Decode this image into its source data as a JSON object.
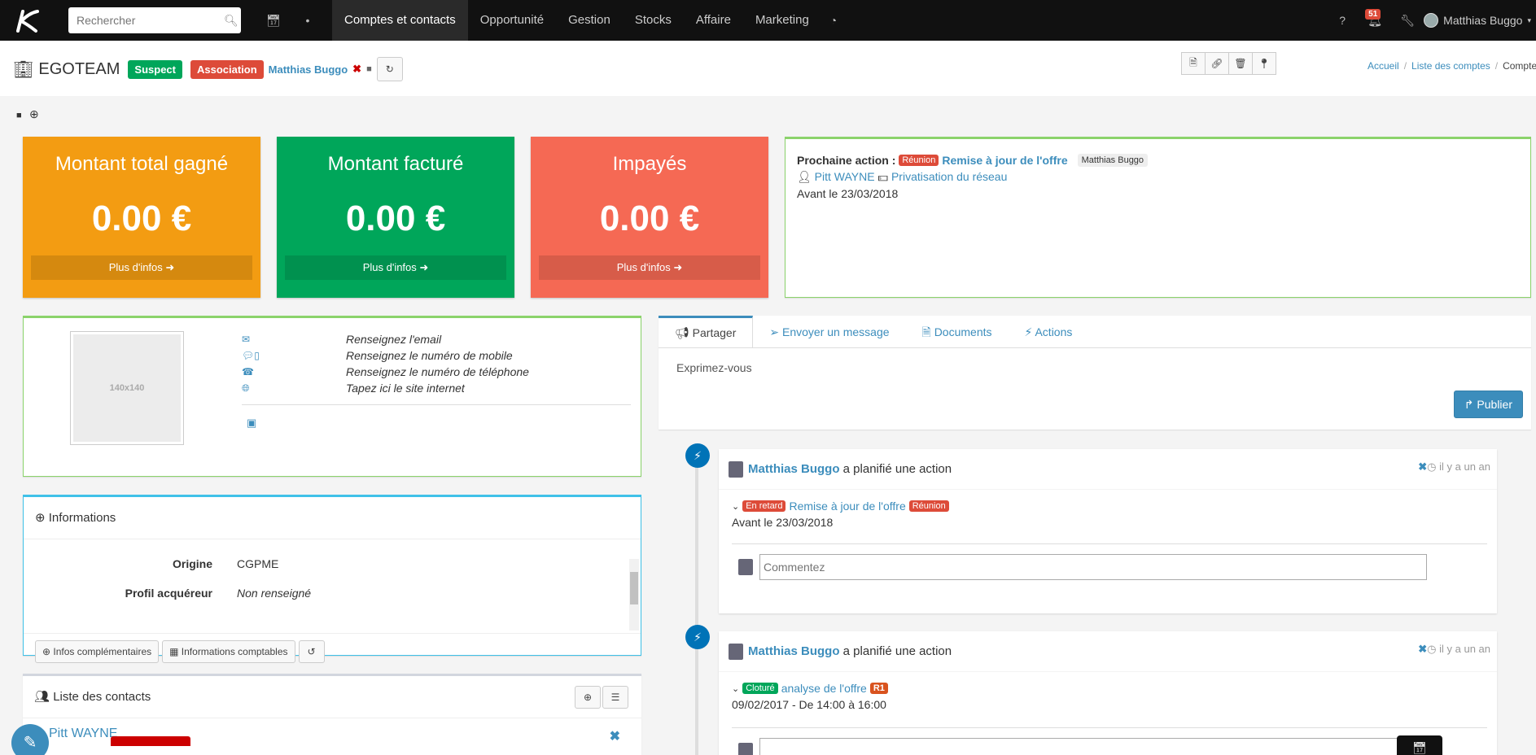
{
  "nav": {
    "search_placeholder": "Rechercher",
    "items": [
      "Comptes et contacts",
      "Opportunité",
      "Gestion",
      "Stocks",
      "Affaire",
      "Marketing"
    ],
    "notifications_count": "51",
    "user_name": "Matthias Buggo"
  },
  "header": {
    "title": "EGOTEAM",
    "status_label": "Suspect",
    "type_label": "Association",
    "owner": "Matthias Buggo",
    "breadcrumb": [
      "Accueil",
      "Liste des comptes",
      "Compte"
    ]
  },
  "stats": [
    {
      "title": "Montant total gagné",
      "amount": "0.00 €",
      "more": "Plus d'infos",
      "color": "#f39c12"
    },
    {
      "title": "Montant facturé",
      "amount": "0.00 €",
      "more": "Plus d'infos",
      "color": "#00a65a"
    },
    {
      "title": "Impayés",
      "amount": "0.00 €",
      "more": "Plus d'infos",
      "color": "#f56954"
    }
  ],
  "next_action": {
    "label": "Prochaine action :",
    "type": "Réunion",
    "title": "Remise à jour de l'offre",
    "owner": "Matthias Buggo",
    "contact": "Pitt WAYNE",
    "opportunity": "Privatisation du réseau",
    "deadline": "Avant le 23/03/2018"
  },
  "profile": {
    "image_placeholder": "140x140",
    "email": "Renseignez l'email",
    "mobile": "Renseignez le numéro de mobile",
    "phone": "Renseignez le numéro de téléphone",
    "website": "Tapez ici le site internet"
  },
  "informations": {
    "title": "Informations",
    "rows": [
      {
        "label": "Origine",
        "value": "CGPME"
      },
      {
        "label": "Profil acquéreur",
        "value": "Non renseigné"
      }
    ],
    "btn_more": "Infos complémentaires",
    "btn_accounting": "Informations comptables"
  },
  "contacts": {
    "title": "Liste des contacts",
    "first": "Pitt WAYNE"
  },
  "tabs": [
    "Partager",
    "Envoyer un message",
    "Documents",
    "Actions"
  ],
  "share": {
    "placeholder": "Exprimez-vous",
    "publish": "Publier"
  },
  "timeline": [
    {
      "author": "Matthias Buggo",
      "verb": "a planifié une action",
      "time": "il y a un an",
      "status": "En retard",
      "title": "Remise à jour de l'offre",
      "type": "Réunion",
      "detail": "Avant le 23/03/2018",
      "comment_placeholder": "Commentez"
    },
    {
      "author": "Matthias Buggo",
      "verb": "a planifié une action",
      "time": "il y a un an",
      "status": "Cloturé",
      "title": "analyse de l'offre",
      "type": "R1",
      "detail": "09/02/2017 - De 14:00 à 16:00"
    }
  ]
}
